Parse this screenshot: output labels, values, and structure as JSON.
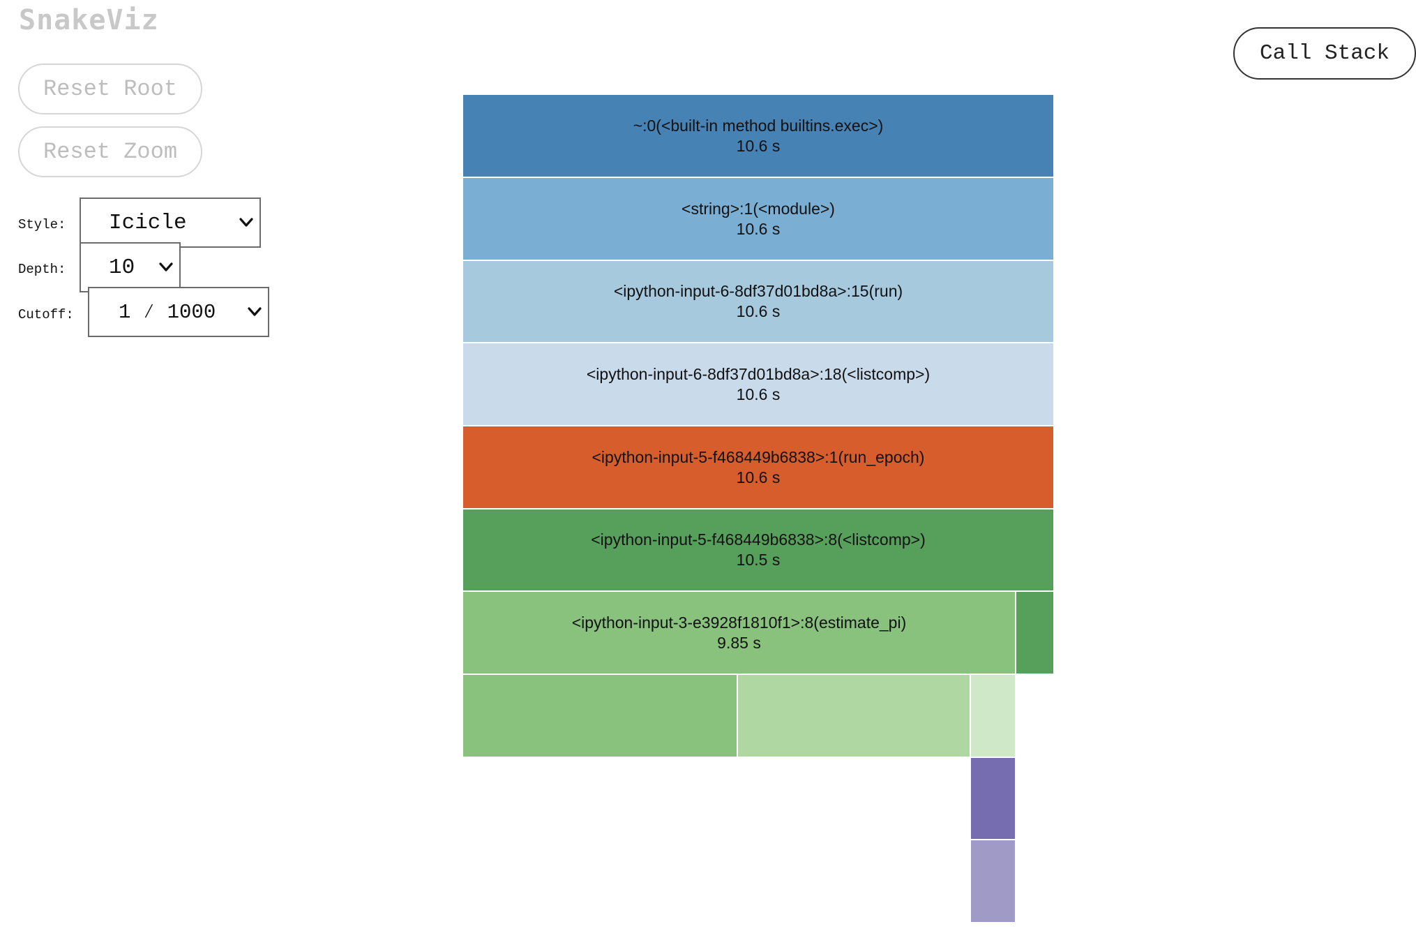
{
  "app": {
    "name": "SnakeViz"
  },
  "sidebar": {
    "reset_root_label": "Reset Root",
    "reset_zoom_label": "Reset Zoom",
    "style": {
      "label": "Style:",
      "value": "Icicle"
    },
    "depth": {
      "label": "Depth:",
      "value": "10"
    },
    "cutoff": {
      "label": "Cutoff:",
      "value": "1 ⁄ 1000"
    }
  },
  "header": {
    "call_stack_label": "Call Stack"
  },
  "icicle": {
    "rows": [
      {
        "name": "~:0(<built-in method builtins.exec>)",
        "time": "10.6 s",
        "color": "#4682b4"
      },
      {
        "name": "<string>:1(<module>)",
        "time": "10.6 s",
        "color": "#7aafd3"
      },
      {
        "name": "<ipython-input-6-8df37d01bd8a>:15(run)",
        "time": "10.6 s",
        "color": "#a7c9de"
      },
      {
        "name": "<ipython-input-6-8df37d01bd8a>:18(<listcomp>)",
        "time": "10.6 s",
        "color": "#c9daeb"
      },
      {
        "name": "<ipython-input-5-f468449b6838>:1(run_epoch)",
        "time": "10.6 s",
        "color": "#d75d2c"
      },
      {
        "name": "<ipython-input-5-f468449b6838>:8(<listcomp>)",
        "time": "10.5 s",
        "color": "#56a05c"
      },
      {
        "name": "<ipython-input-3-e3928f1810f1>:8(estimate_pi)",
        "time": "9.85 s",
        "color": "#88c27d"
      }
    ],
    "unlabeled_blocks": [
      {
        "color": "#56a05c"
      },
      {
        "color": "#88c27d"
      },
      {
        "color": "#afd7a1"
      },
      {
        "color": "#cfe8c8"
      },
      {
        "color": "#756db0"
      },
      {
        "color": "#9f9bc6"
      }
    ]
  }
}
